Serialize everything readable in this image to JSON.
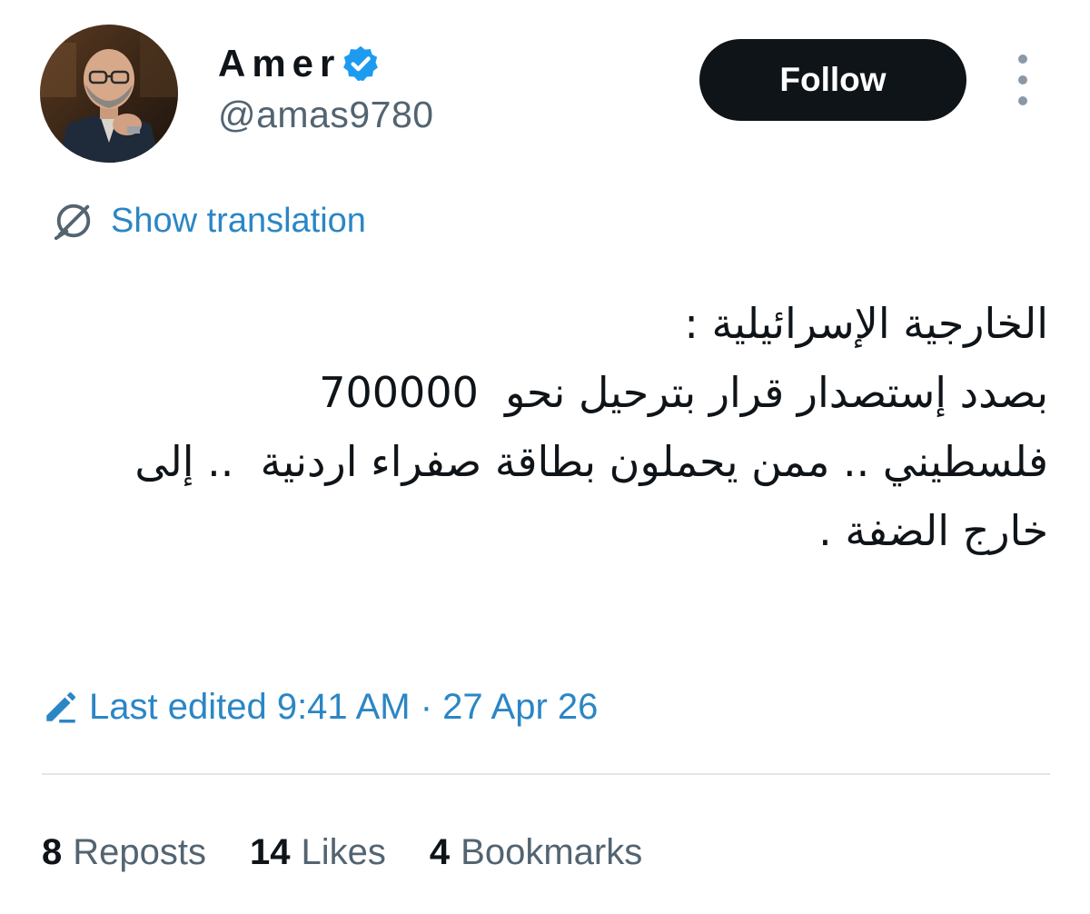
{
  "author": {
    "display_name": "Amer",
    "handle": "@amas9780",
    "verified": true
  },
  "actions": {
    "follow_label": "Follow"
  },
  "translation": {
    "label": "Show translation"
  },
  "tweet": {
    "lines": [
      "الخارجية الإسرائيلية :",
      "بصدد إستصدار قرار بترحيل نحو  700000",
      "فلسطيني .. ممن يحملون بطاقة صفراء اردنية  .. إلى",
      "خارج الضفة ."
    ]
  },
  "edit_info": {
    "label": "Last edited 9:41 AM · 27 Apr 26"
  },
  "stats": {
    "reposts": {
      "count": "8",
      "label": "Reposts"
    },
    "likes": {
      "count": "14",
      "label": "Likes"
    },
    "bookmarks": {
      "count": "4",
      "label": "Bookmarks"
    }
  },
  "colors": {
    "link": "#2b86c5",
    "verified_badge": "#1d9bf0",
    "follow_bg": "#0f1419",
    "muted_text": "#536471"
  },
  "icons": {
    "verified": "verified-badge-icon",
    "translate": "translate-globe-icon",
    "edit": "pencil-edit-icon",
    "more": "more-vertical-icon"
  }
}
